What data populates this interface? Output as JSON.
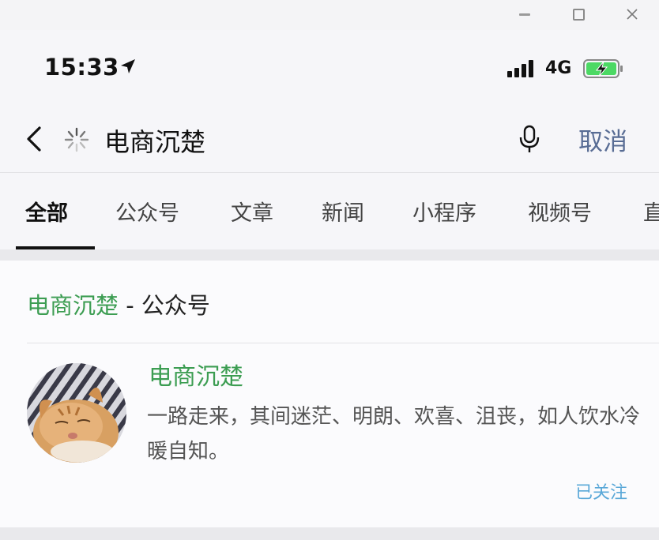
{
  "status_bar": {
    "time": "15:33",
    "network": "4G"
  },
  "search": {
    "query": "电商沉楚",
    "cancel_label": "取消"
  },
  "tabs": [
    {
      "label": "全部",
      "active": true
    },
    {
      "label": "公众号"
    },
    {
      "label": "文章"
    },
    {
      "label": "新闻"
    },
    {
      "label": "小程序"
    },
    {
      "label": "视频号"
    },
    {
      "label": "直"
    }
  ],
  "section": {
    "title_highlight": "电商沉楚",
    "title_rest": " - 公众号"
  },
  "result": {
    "name": "电商沉楚",
    "description": "一路走来，其间迷茫、明朗、欢喜、沮丧，如人饮水冷暖自知。",
    "follow_status": "已关注"
  },
  "colors": {
    "highlight_green": "#3c9d52",
    "cancel_blue": "#586c94",
    "follow_blue": "#5aa8d8",
    "battery_green": "#4cd964"
  }
}
